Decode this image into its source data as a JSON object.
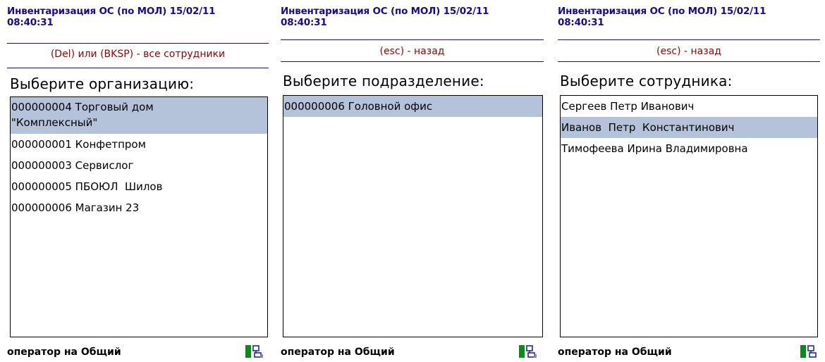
{
  "panels": [
    {
      "title_line1": "Инвентаризация ОС (по МОЛ) 15/02/11",
      "title_line2": "08:40:31",
      "hint": "(Del) или (BKSP) - все сотрудники",
      "heading": "Выберите организацию:",
      "items": [
        {
          "text": "000000004 Торговый дом\n\"Комплексный\"",
          "selected": true
        },
        {
          "text": "000000001 Конфетпром",
          "selected": false
        },
        {
          "text": "000000003 Сервислог",
          "selected": false
        },
        {
          "text": "000000005 ПБОЮЛ  Шилов",
          "selected": false
        },
        {
          "text": "000000006 Магазин 23",
          "selected": false
        }
      ],
      "status": "оператор на Общий"
    },
    {
      "title_line1": "Инвентаризация ОС (по МОЛ) 15/02/11",
      "title_line2": "08:40:31",
      "hint": "(esc) - назад",
      "heading": "Выберите подразделение:",
      "items": [
        {
          "text": "000000006 Головной офис",
          "selected": true
        }
      ],
      "status": "оператор на Общий"
    },
    {
      "title_line1": "Инвентаризация ОС (по МОЛ) 15/02/11",
      "title_line2": "08:40:31",
      "hint": "(esc) - назад",
      "heading": "Выберите сотрудника:",
      "items": [
        {
          "text": "Сергеев Петр Иванович",
          "selected": false
        },
        {
          "text": "Иванов  Петр  Константинович",
          "selected": true
        },
        {
          "text": "Тимофеева Ирина Владимировна",
          "selected": false
        }
      ],
      "status": "оператор на Общий"
    }
  ],
  "colors": {
    "title": "#1a0a8c",
    "hint": "#990000",
    "selection": "#b4c3da",
    "tray_green": "#0a8a18"
  },
  "icons": {
    "tray": "network-status-icon"
  }
}
